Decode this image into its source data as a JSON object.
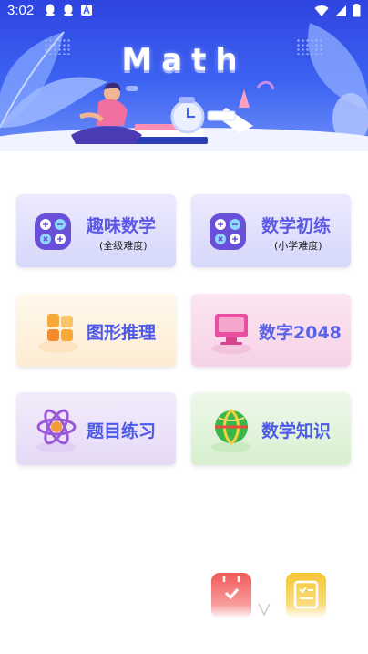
{
  "status_bar": {
    "time": "3:02"
  },
  "banner": {
    "title": "Math"
  },
  "cards": [
    {
      "label": "趣味数学",
      "sub": "(全级难度)"
    },
    {
      "label": "数学初练",
      "sub": "(小学难度)"
    },
    {
      "label": "图形推理"
    },
    {
      "label": "数字2048"
    },
    {
      "label": "题目练习"
    },
    {
      "label": "数学知识"
    }
  ],
  "colors": {
    "banner_blue": "#3d63f2",
    "accent_purple": "#6a4fd8",
    "float_red": "#f25a5a",
    "float_yellow": "#f7c531"
  }
}
